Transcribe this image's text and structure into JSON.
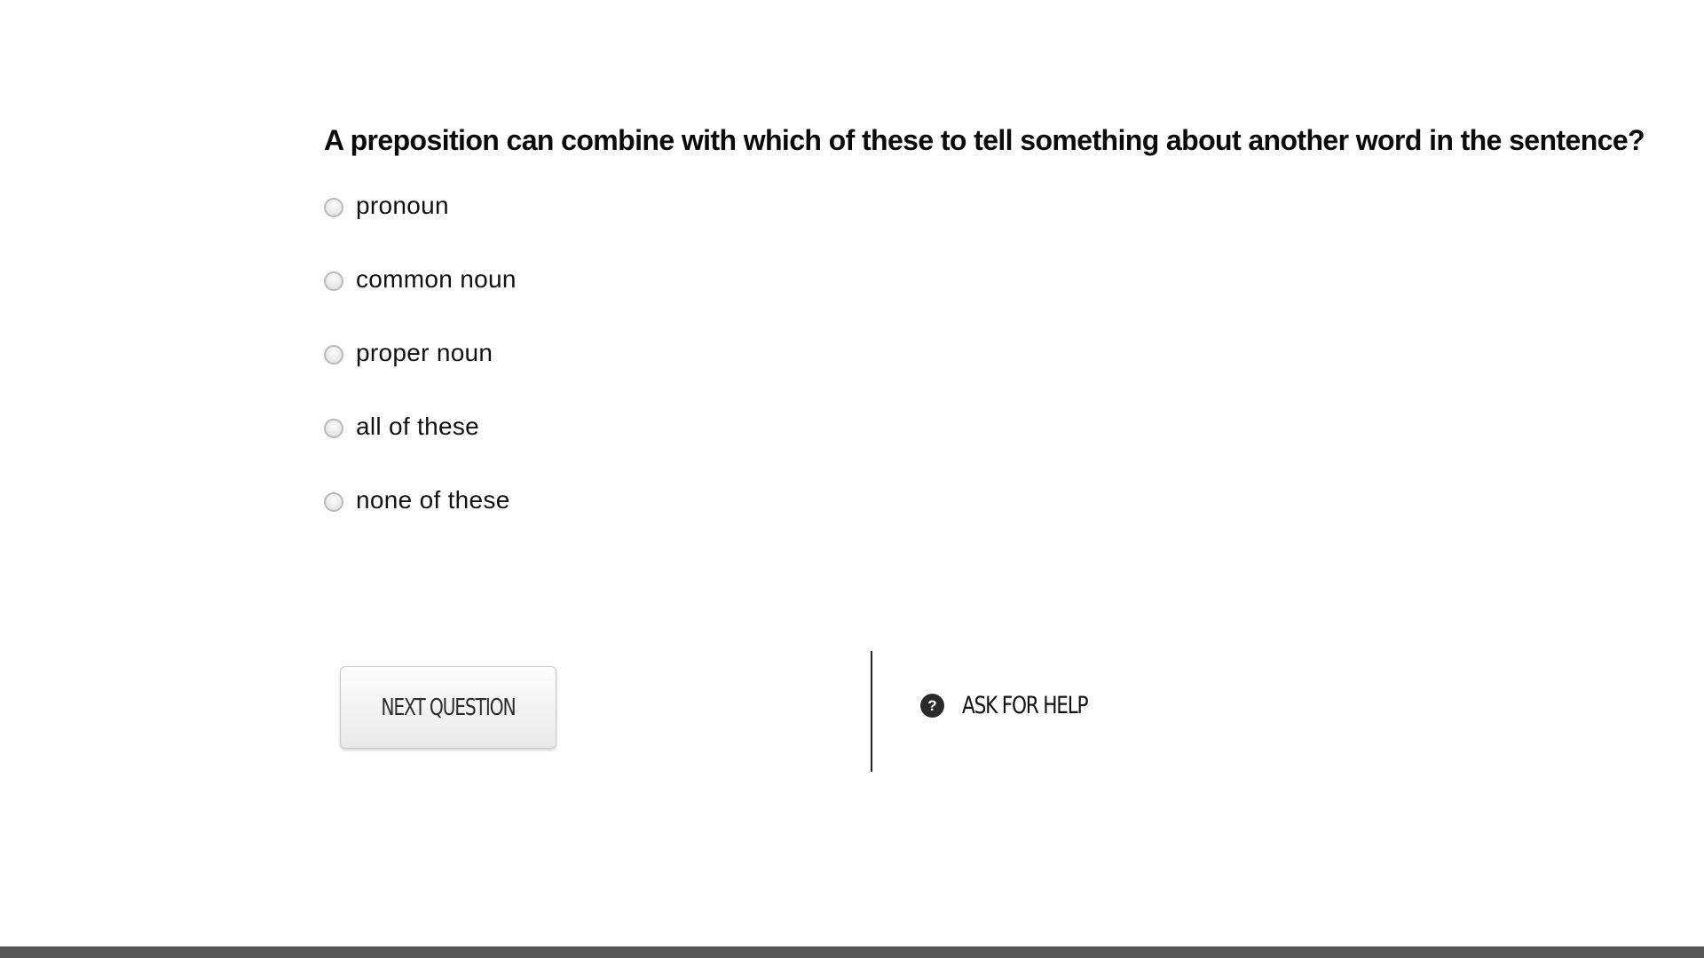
{
  "question": {
    "text": "A preposition can combine with which of these to tell something about another word in the sentence?"
  },
  "options": [
    {
      "label": "pronoun",
      "selected": false
    },
    {
      "label": "common noun",
      "selected": false
    },
    {
      "label": "proper noun",
      "selected": false
    },
    {
      "label": "all of these",
      "selected": false
    },
    {
      "label": "none of these",
      "selected": false
    }
  ],
  "actions": {
    "next_label": "NEXT QUESTION",
    "help_label": "ASK FOR HELP",
    "help_icon": "question-circle-icon",
    "help_icon_glyph": "?"
  },
  "colors": {
    "footer_bar": "#555555",
    "button_border": "#c8c8c8",
    "help_icon_bg": "#2a2a2a"
  }
}
